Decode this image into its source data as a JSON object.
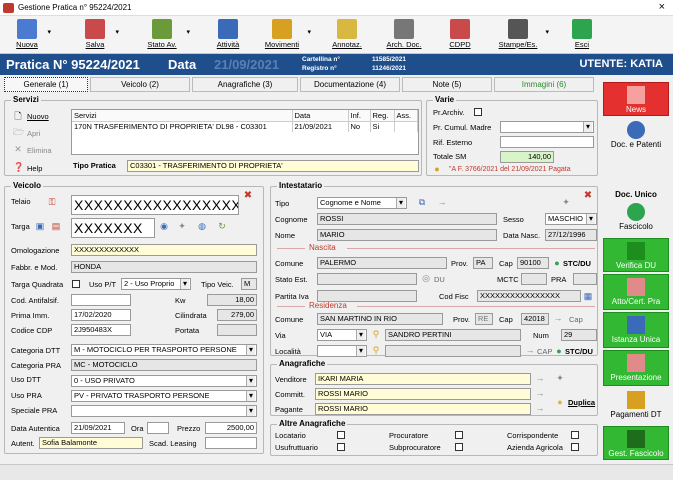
{
  "window": {
    "title": "Gestione Pratica n° 95224/2021",
    "close": "×"
  },
  "toolbar": [
    {
      "label": "Nuova",
      "icon": "new-doc-icon",
      "color": "#4a7bd0"
    },
    {
      "label": "Salva",
      "icon": "save-icon",
      "color": "#c84a4a"
    },
    {
      "label": "Stato Av.",
      "icon": "status-list-icon",
      "color": "#6a9a3a"
    },
    {
      "label": "Attività",
      "icon": "checklist-icon",
      "color": "#3a6ab8"
    },
    {
      "label": "Movimenti",
      "icon": "money-icon",
      "color": "#d8a020"
    },
    {
      "label": "Annotaz.",
      "icon": "notes-icon",
      "color": "#d8b840"
    },
    {
      "label": "Arch. Doc.",
      "icon": "archive-icon",
      "color": "#777777"
    },
    {
      "label": "CDPD",
      "icon": "cdpd-icon",
      "color": "#c84a4a"
    },
    {
      "label": "Stampe/Es.",
      "icon": "printer-icon",
      "color": "#555555"
    },
    {
      "label": "Esci",
      "icon": "exit-icon",
      "color": "#2ea44f"
    }
  ],
  "header": {
    "pratica": "Pratica N°  95224/2021",
    "data_label": "Data",
    "data_value": "21/09/2021",
    "cartellina_label": "Cartellina n°",
    "registro_label": "Registro n°",
    "cartellina_value": "11585/2021",
    "registro_value": "11246/2021",
    "utente": "UTENTE: KATIA"
  },
  "tabs": [
    "Generale  (1)",
    "Veicolo  (2)",
    "Anagrafiche  (3)",
    "Documentazione  (4)",
    "Note  (5)",
    "Immagini  (6)"
  ],
  "servizi": {
    "title": "Servizi",
    "nuovo": "Nuovo",
    "apri": "Apri",
    "elimina": "Elimina",
    "help": "Help",
    "cols": [
      "Servizi",
      "Data",
      "Inf.",
      "Reg.",
      "Ass."
    ],
    "row": [
      "170N TRASFERIMENTO DI PROPRIETA' DL98 - C03301",
      "21/09/2021",
      "No",
      "Si",
      ""
    ],
    "tipo_label": "Tipo Pratica",
    "tipo_value": "C03301 - TRASFERIMENTO DI PROPRIETA'"
  },
  "varie": {
    "title": "Varie",
    "prarchiv": "Pr.Archiv.",
    "cumul": "Pr. Cumul. Madre",
    "rif": "Rif. Esterno",
    "totale": "Totale SM",
    "totale_value": "140,00",
    "fattura": "\"A  F. 3766/2021 del 21/09/2021 Pagata"
  },
  "veicolo": {
    "title": "Veicolo",
    "telaio_label": "Telaio",
    "telaio": "XXXXXXXXXXXXXXXXX",
    "targa_label": "Targa",
    "targa": "XXXXXXX",
    "omolog_label": "Omologazione",
    "omolog": "XXXXXXXXXXXXX",
    "fabbr_label": "Fabbr. e Mod.",
    "fabbr": "HONDA",
    "tq_label": "Targa Quadrata",
    "usopt_label": "Uso P/T",
    "usopt": "2 - Uso Proprio",
    "tipoveic_label": "Tipo Veic.",
    "tipoveic": "M",
    "antifals_label": "Cod. Antifalsif.",
    "kw_label": "Kw",
    "kw": "18,00",
    "primaimm_label": "Prima Imm.",
    "primaimm": "17/02/2020",
    "cil_label": "Cilindrata",
    "cil": "279,00",
    "cdp_label": "Codice CDP",
    "cdp": "2J950483X",
    "portata_label": "Portata",
    "catdtt_label": "Categoria DTT",
    "catdtt": "M - MOTOCICLO PER TRASPORTO PERSONE",
    "catpra_label": "Categoria PRA",
    "catpra": "MC - MOTOCICLO",
    "usodtt_label": "Uso DTT",
    "usodtt": "0 - USO PRIVATO",
    "usopra_label": "Uso PRA",
    "usopra": "PV - PRIVATO TRASPORTO PERSONE",
    "specpra_label": "Speciale PRA",
    "dataaut_label": "Data Autentica",
    "dataaut": "21/09/2021",
    "ora_label": "Ora",
    "prezzo_label": "Prezzo",
    "prezzo": "2500,00",
    "autent_label": "Autent.",
    "autent": "Sofia Balamonte",
    "scad_label": "Scad. Leasing"
  },
  "intestatario": {
    "title": "Intestatario",
    "tipo_label": "Tipo",
    "tipo": "Cognome e Nome",
    "cognome_label": "Cognome",
    "cognome": "ROSSI",
    "sesso_label": "Sesso",
    "sesso": "MASCHIO",
    "nome_label": "Nome",
    "nome": "MARIO",
    "datanasc_label": "Data Nasc.",
    "datanasc": "27/12/1996",
    "nascita": "Nascita",
    "comune_label": "Comune",
    "comune": "PALERMO",
    "prov_label": "Prov.",
    "prov": "PA",
    "cap_label": "Cap",
    "cap": "90100",
    "stcdu": "STC/DU",
    "statoest_label": "Stato Est.",
    "du": "DU",
    "mctc": "MCTC",
    "pra": "PRA",
    "piva_label": "Partita Iva",
    "codfisc_label": "Cod Fisc",
    "codfisc": "XXXXXXXXXXXXXXXX",
    "residenza": "Residenza",
    "rcomune": "SAN MARTINO IN RIO",
    "rprov": "RE",
    "rcap": "42018",
    "capr": "Cap",
    "via_label": "Via",
    "via": "VIA",
    "viaval": "SANDRO PERTINI",
    "num_label": "Num",
    "num": "29",
    "localita_label": "Località",
    "cap2": "CAP",
    "stcdu2": "STC/DU"
  },
  "anagrafiche": {
    "title": "Anagrafiche",
    "venditore_label": "Venditore",
    "venditore": "IKARI MARIA",
    "committ_label": "Committ.",
    "committ": "ROSSI MARIO",
    "pagante_label": "Pagante",
    "pagante": "ROSSI MARIO",
    "duplica": "Duplica"
  },
  "altre": {
    "title": "Altre Anagrafiche",
    "items": [
      "Locatario",
      "Procuratore",
      "Corrispondente",
      "Usufruttuario",
      "Subprocuratore",
      "Azienda Agricola"
    ]
  },
  "side": {
    "news": "News",
    "docpatenti": "Doc. e Patenti",
    "docunico": "Doc. Unico",
    "fascicolo": "Fascicolo",
    "verifica": "Verifica DU",
    "atto": "Atto/Cert. Pra",
    "istanza": "Istanza Unica",
    "present": "Presentazione",
    "pagamenti": "Pagamenti DT",
    "gest": "Gest. Fascicolo"
  }
}
